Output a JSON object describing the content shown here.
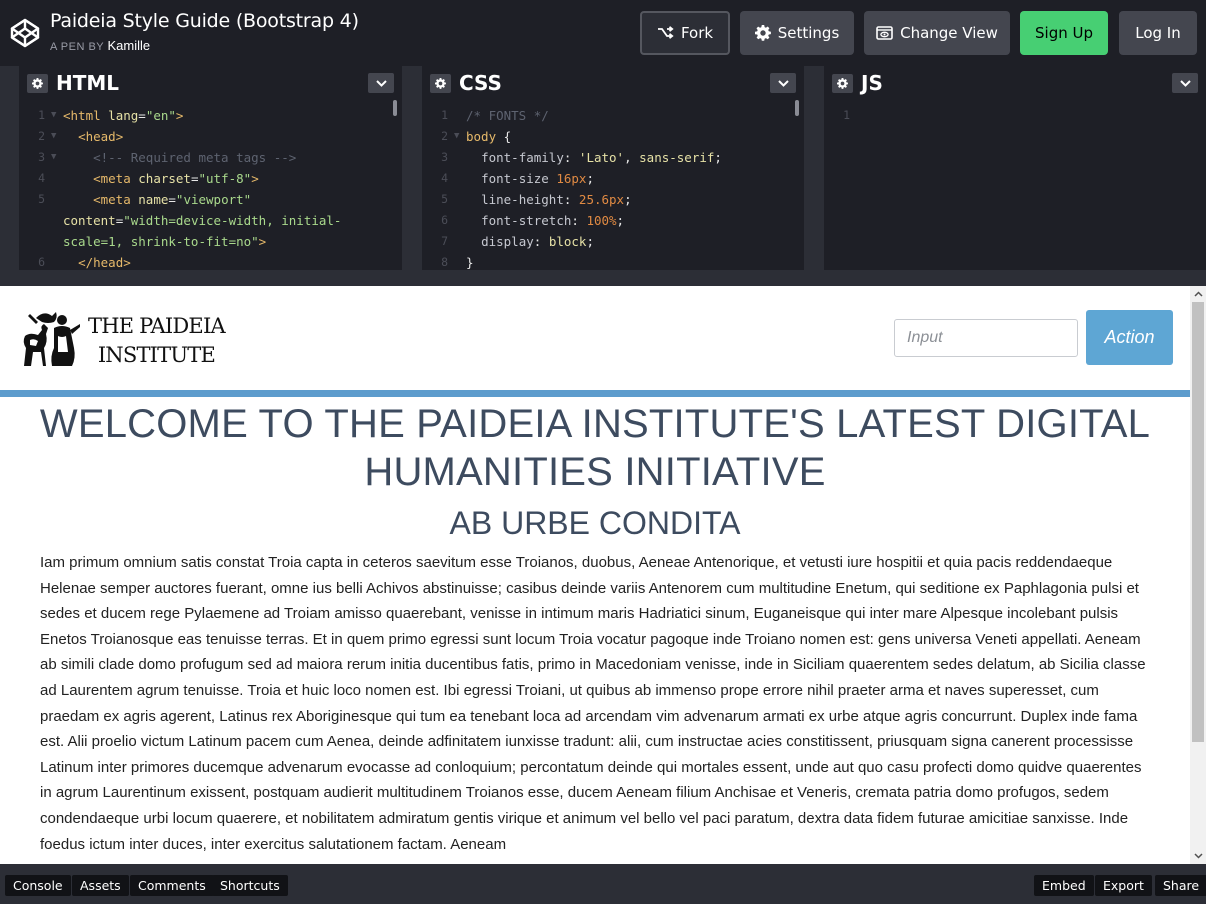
{
  "header": {
    "title": "Paideia Style Guide (Bootstrap 4)",
    "byline_prefix": "A PEN BY",
    "author": "Kamille",
    "buttons": {
      "fork": "Fork",
      "settings": "Settings",
      "change_view": "Change View",
      "sign_up": "Sign Up",
      "log_in": "Log In"
    }
  },
  "editors": {
    "html": {
      "name": "HTML",
      "line_numbers": [
        "1",
        "2",
        "3",
        "4",
        "5",
        "",
        "",
        "6"
      ]
    },
    "css": {
      "name": "CSS",
      "line_numbers": [
        "1",
        "2",
        "3",
        "4",
        "5",
        "6",
        "7",
        "8"
      ]
    },
    "js": {
      "name": "JS",
      "line_numbers": [
        "1"
      ]
    }
  },
  "preview": {
    "brand_line1": "THE PAIDEIA",
    "brand_line2": "INSTITUTE",
    "input_placeholder": "Input",
    "action_label": "Action",
    "headline": "WELCOME TO THE PAIDEIA INSTITUTE'S LATEST DIGITAL HUMANITIES INITIATIVE",
    "subhead": "AB URBE CONDITA",
    "paragraph": "Iam primum omnium satis constat Troia capta in ceteros saevitum esse Troianos, duobus, Aeneae Antenorique, et vetusti iure hospitii et quia pacis reddendaeque Helenae semper auctores fuerant, omne ius belli Achivos abstinuisse; casibus deinde variis Antenorem cum multitudine Enetum, qui seditione ex Paphlagonia pulsi et sedes et ducem rege Pylaemene ad Troiam amisso quaerebant, venisse in intimum maris Hadriatici sinum, Euganeisque qui inter mare Alpesque incolebant pulsis Enetos Troianosque eas tenuisse terras. Et in quem primo egressi sunt locum Troia vocatur pagoque inde Troiano nomen est: gens universa Veneti appellati. Aeneam ab simili clade domo profugum sed ad maiora rerum initia ducentibus fatis, primo in Macedoniam venisse, inde in Siciliam quaerentem sedes delatum, ab Sicilia classe ad Laurentem agrum tenuisse. Troia et huic loco nomen est. Ibi egressi Troiani, ut quibus ab immenso prope errore nihil praeter arma et naves superesset, cum praedam ex agris agerent, Latinus rex Aboriginesque qui tum ea tenebant loca ad arcendam vim advenarum armati ex urbe atque agris concurrunt. Duplex inde fama est. Alii proelio victum Latinum pacem cum Aenea, deinde adfinitatem iunxisse tradunt: alii, cum instructae acies constitissent, priusquam signa canerent processisse Latinum inter primores ducemque advenarum evocasse ad conloquium; percontatum deinde qui mortales essent, unde aut quo casu profecti domo quidve quaerentes in agrum Laurentinum exissent, postquam audierit multitudinem Troianos esse, ducem Aeneam filium Anchisae et Veneris, cremata patria domo profugos, sedem condendaeque urbi locum quaerere, et nobilitatem admiratum gentis virique et animum vel bello vel paci paratum, dextra data fidem futurae amicitiae sanxisse. Inde foedus ictum inter duces, inter exercitus salutationem factam. Aeneam"
  },
  "footer": {
    "left": [
      "Console",
      "Assets",
      "Comments",
      "Shortcuts"
    ],
    "right": [
      "Embed",
      "Export",
      "Share"
    ]
  },
  "colors": {
    "accent_green": "#47cf73",
    "preview_blue": "#5d9ccd",
    "headline_color": "#3d4b5f",
    "ui_dark": "#1e1f26"
  },
  "icons": [
    "codepen-logo-icon",
    "fork-icon",
    "gear-icon",
    "change-view-icon",
    "chevron-down-icon",
    "paideia-logo-image"
  ]
}
